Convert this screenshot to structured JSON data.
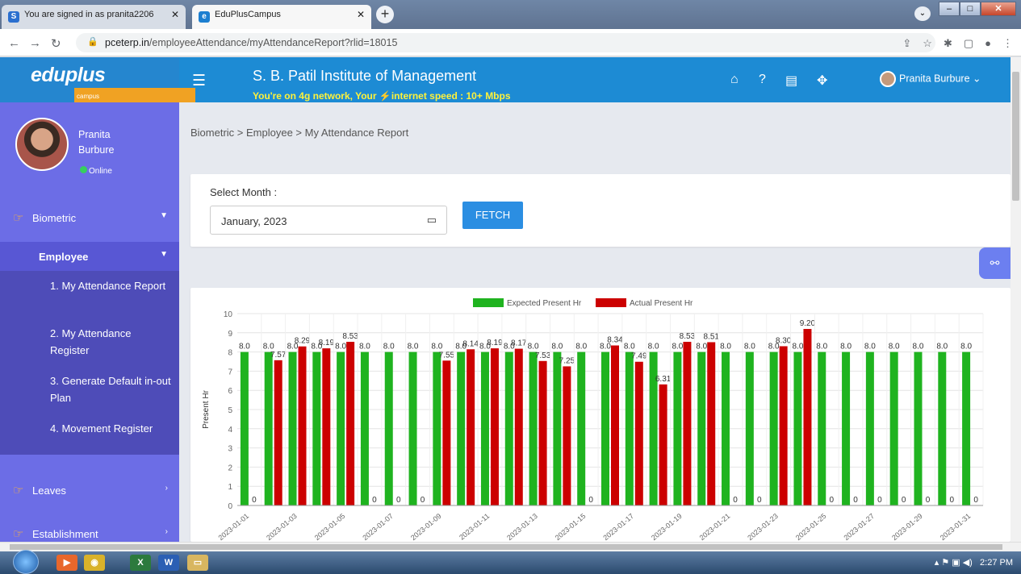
{
  "browser": {
    "tabs": [
      {
        "label": "You are signed in as pranita2206",
        "icon": "s-favicon"
      },
      {
        "label": "EduPlusCampus",
        "icon": "eduplus-favicon"
      }
    ],
    "url_domain": "pceterp.in",
    "url_path": "/employeeAttendance/myAttendanceReport?rlid=18015"
  },
  "header": {
    "logo": "eduplus",
    "logo_sub": "campus",
    "institute": "S. B. Patil Institute of Management",
    "network_msg": "You're on 4g network, Your ⚡internet speed : 10+ Mbps",
    "user": "Pranita Burbure"
  },
  "sidebar": {
    "profile_name": "Pranita Burbure",
    "status": "Online",
    "menu": [
      {
        "label": "Biometric"
      },
      {
        "label": "Employee"
      },
      {
        "label": "1. My Attendance Report"
      },
      {
        "label": "2. My Attendance Register"
      },
      {
        "label": "3. Generate Default in-out Plan"
      },
      {
        "label": "4. Movement Register"
      },
      {
        "label": "Leaves"
      },
      {
        "label": "Establishment"
      }
    ]
  },
  "main": {
    "breadcrumb": "Biometric > Employee > My Attendance Report",
    "select_month_label": "Select Month :",
    "month_value": "January, 2023",
    "fetch_label": "FETCH"
  },
  "chart_data": {
    "type": "bar",
    "ylabel": "Present Hr",
    "ylim": [
      0,
      10
    ],
    "colors": {
      "expected": "#1fb31f",
      "actual": "#cc0000"
    },
    "categories": [
      "2023-01-01",
      "2023-01-02",
      "2023-01-03",
      "2023-01-04",
      "2023-01-05",
      "2023-01-06",
      "2023-01-07",
      "2023-01-08",
      "2023-01-09",
      "2023-01-10",
      "2023-01-11",
      "2023-01-12",
      "2023-01-13",
      "2023-01-14",
      "2023-01-15",
      "2023-01-16",
      "2023-01-17",
      "2023-01-18",
      "2023-01-19",
      "2023-01-20",
      "2023-01-21",
      "2023-01-22",
      "2023-01-23",
      "2023-01-24",
      "2023-01-25",
      "2023-01-26",
      "2023-01-27",
      "2023-01-28",
      "2023-01-29",
      "2023-01-30",
      "2023-01-31"
    ],
    "tick_labels": [
      "2023-01-01",
      "2023-01-03",
      "2023-01-05",
      "2023-01-07",
      "2023-01-09",
      "2023-01-11",
      "2023-01-13",
      "2023-01-15",
      "2023-01-17",
      "2023-01-19",
      "2023-01-21",
      "2023-01-23",
      "2023-01-25",
      "2023-01-27",
      "2023-01-29",
      "2023-01-31"
    ],
    "series": [
      {
        "name": "Expected Present Hr",
        "values": [
          8,
          8,
          8,
          8,
          8,
          8,
          8,
          8,
          8,
          8,
          8,
          8,
          8,
          8,
          8,
          8,
          8,
          8,
          8,
          8,
          8,
          8,
          8,
          8,
          8,
          8,
          8,
          8,
          8,
          8,
          8
        ],
        "labels": [
          "8.0",
          "8.0",
          "8.0",
          "8.0",
          "8.0",
          "8.0",
          "8.0",
          "8.0",
          "8.0",
          "8.0",
          "8.0",
          "8.0",
          "8.0",
          "8.0",
          "8.0",
          "8.0",
          "8.0",
          "8.0",
          "8.0",
          "8.0",
          "8.0",
          "8.0",
          "8.0",
          "8.0",
          "8.0",
          "8.0",
          "8.0",
          "8.0",
          "8.0",
          "8.0",
          "8.0"
        ]
      },
      {
        "name": "Actual Present Hr",
        "values": [
          0,
          7.57,
          8.29,
          8.19,
          8.53,
          0,
          0,
          0,
          7.55,
          8.14,
          8.19,
          8.17,
          7.53,
          7.25,
          0,
          8.34,
          7.49,
          6.31,
          8.53,
          8.51,
          0,
          0,
          8.3,
          9.2,
          0,
          0,
          0,
          0,
          0,
          0,
          0
        ],
        "labels": [
          "0",
          "7.57",
          "8.29",
          "8.19",
          "8.53",
          "0",
          "0",
          "0",
          "7.55",
          "8.14",
          "8.19",
          "8.17",
          "7.53",
          "7.25",
          "0",
          "8.34",
          "7.49",
          "6.31",
          "8.53",
          "8.51",
          "0",
          "0",
          "8.30",
          "9.20",
          "0",
          "0",
          "0",
          "0",
          "0",
          "0",
          "0"
        ]
      }
    ],
    "yticks": [
      0,
      1,
      2,
      3,
      4,
      5,
      6,
      7,
      8,
      9,
      10
    ],
    "legend_position": "top-center",
    "grid": true
  },
  "taskbar": {
    "time": "2:27 PM"
  }
}
